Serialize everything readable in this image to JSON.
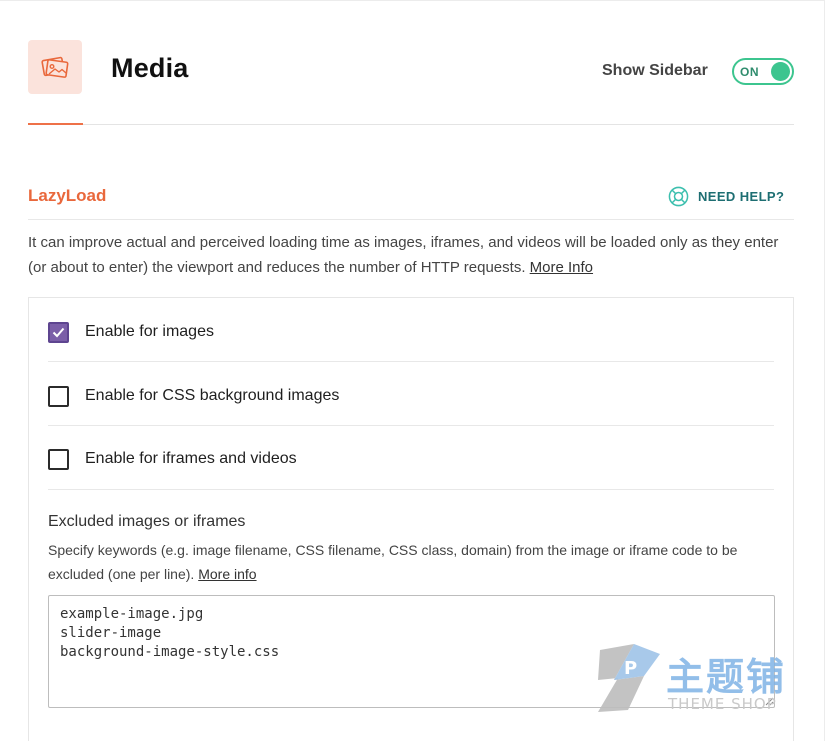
{
  "header": {
    "title": "Media",
    "show_sidebar_label": "Show Sidebar",
    "toggle_state": "ON",
    "icon": "images-icon",
    "toggle_color": "#3cc58f",
    "accent": "#ee7148"
  },
  "lazyload": {
    "title": "LazyLoad",
    "help_label": "NEED HELP?",
    "help_icon": "lifebuoy-icon",
    "description": "It can improve actual and perceived loading time as images, iframes, and videos will be loaded only as they enter (or about to enter) the viewport and reduces the number of HTTP requests.",
    "more_info": "More Info",
    "options": [
      {
        "label": "Enable for images",
        "checked": true
      },
      {
        "label": "Enable for CSS background images",
        "checked": false
      },
      {
        "label": "Enable for iframes and videos",
        "checked": false
      }
    ],
    "excluded": {
      "title": "Excluded images or iframes",
      "description": "Specify keywords (e.g. image filename, CSS filename, CSS class, domain) from the image or iframe code to be excluded (one per line).",
      "more_info": "More info",
      "value": "example-image.jpg\nslider-image\nbackground-image-style.css"
    }
  },
  "watermark": {
    "logo_text": "主题铺",
    "sub_text": "THEME SHOP"
  }
}
